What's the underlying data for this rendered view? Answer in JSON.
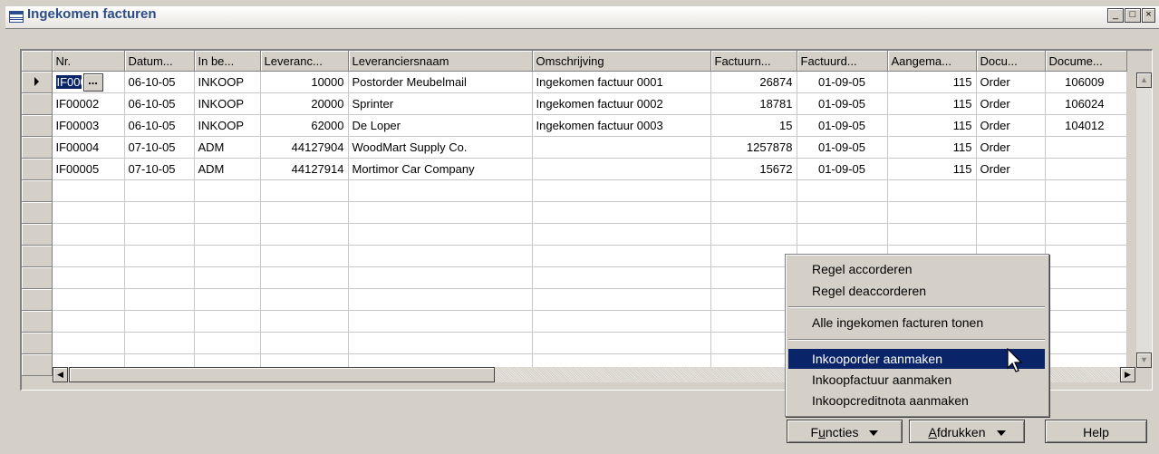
{
  "window": {
    "title": "Ingekomen facturen",
    "min_label": "_",
    "max_label": "□",
    "close_label": "×"
  },
  "columns": [
    "Nr.",
    "Datum...",
    "In be...",
    "Leveranc...",
    "Leveranciersnaam",
    "Omschrijving",
    "Factuurn...",
    "Factuurd...",
    "Aangema...",
    "Docu...",
    "Docume..."
  ],
  "rows": [
    {
      "nr": "IF0000",
      "datum": "06-10-05",
      "inbe": "INKOOP",
      "lev": "10000",
      "naam": "Postorder Meubelmail",
      "oms": "Ingekomen factuur 0001",
      "fnr": "26874",
      "fdat": "01-09-05",
      "aang": "115",
      "doc": "Order",
      "docnr": "106009"
    },
    {
      "nr": "IF00002",
      "datum": "06-10-05",
      "inbe": "INKOOP",
      "lev": "20000",
      "naam": "Sprinter",
      "oms": "Ingekomen factuur 0002",
      "fnr": "18781",
      "fdat": "01-09-05",
      "aang": "115",
      "doc": "Order",
      "docnr": "106024"
    },
    {
      "nr": "IF00003",
      "datum": "06-10-05",
      "inbe": "INKOOP",
      "lev": "62000",
      "naam": "De Loper",
      "oms": "Ingekomen factuur 0003",
      "fnr": "15",
      "fdat": "01-09-05",
      "aang": "115",
      "doc": "Order",
      "docnr": "104012"
    },
    {
      "nr": "IF00004",
      "datum": "07-10-05",
      "inbe": "ADM",
      "lev": "44127904",
      "naam": "WoodMart Supply Co.",
      "oms": "",
      "fnr": "1257878",
      "fdat": "01-09-05",
      "aang": "115",
      "doc": "Order",
      "docnr": ""
    },
    {
      "nr": "IF00005",
      "datum": "07-10-05",
      "inbe": "ADM",
      "lev": "44127914",
      "naam": "Mortimor Car Company",
      "oms": "",
      "fnr": "15672",
      "fdat": "01-09-05",
      "aang": "115",
      "doc": "Order",
      "docnr": ""
    }
  ],
  "empty_row_count": 9,
  "cell_button_label": "...",
  "context_menu": {
    "items": [
      {
        "label": "Regel accorderen"
      },
      {
        "label": "Regel deaccorderen"
      },
      {
        "label": "Alle ingekomen facturen tonen"
      },
      {
        "label": "Inkooporder aanmaken"
      },
      {
        "label": "Inkoopfactuur aanmaken"
      },
      {
        "label": "Inkoopcreditnota aanmaken"
      }
    ],
    "active_item": "Inkooporder aanmaken"
  },
  "buttons": {
    "functies_pre": "F",
    "functies_u": "u",
    "functies_post": "ncties",
    "afdrukken_u": "A",
    "afdrukken_post": "fdrukken",
    "help": "Help"
  },
  "colors": {
    "selection": "#0a246a",
    "title_text": "#2a4c8c",
    "face": "#d4d0c8"
  }
}
